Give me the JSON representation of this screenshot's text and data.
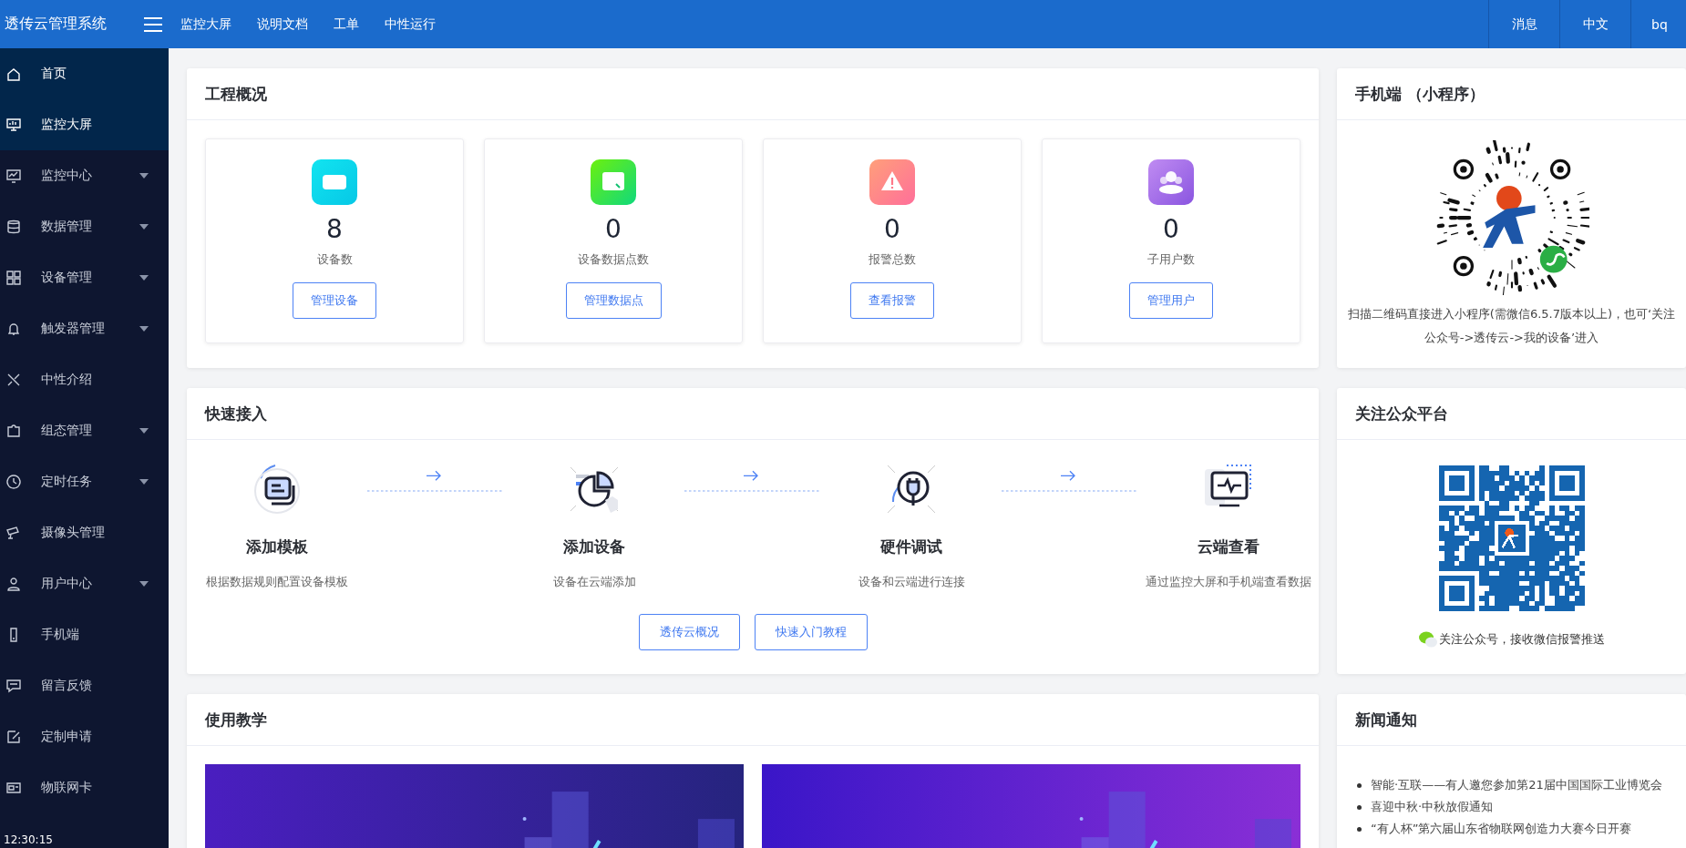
{
  "header": {
    "title": "透传云管理系统",
    "menu_items": [
      "监控大屏",
      "说明文档",
      "工单",
      "中性运行"
    ],
    "right_items": [
      "消息",
      "中文",
      "bq"
    ]
  },
  "sidebar": {
    "items": [
      {
        "label": "首页",
        "selected": true,
        "expandable": false
      },
      {
        "label": "监控大屏",
        "selected": true,
        "expandable": false
      },
      {
        "label": "监控中心",
        "selected": false,
        "expandable": true
      },
      {
        "label": "数据管理",
        "selected": false,
        "expandable": true
      },
      {
        "label": "设备管理",
        "selected": false,
        "expandable": true
      },
      {
        "label": "触发器管理",
        "selected": false,
        "expandable": true
      },
      {
        "label": "中性介绍",
        "selected": false,
        "expandable": false
      },
      {
        "label": "组态管理",
        "selected": false,
        "expandable": true
      },
      {
        "label": "定时任务",
        "selected": false,
        "expandable": true
      },
      {
        "label": "摄像头管理",
        "selected": false,
        "expandable": false
      },
      {
        "label": "用户中心",
        "selected": false,
        "expandable": true
      },
      {
        "label": "手机端",
        "selected": false,
        "expandable": false
      },
      {
        "label": "留言反馈",
        "selected": false,
        "expandable": false
      },
      {
        "label": "定制申请",
        "selected": false,
        "expandable": false
      },
      {
        "label": "物联网卡",
        "selected": false,
        "expandable": false
      }
    ],
    "clock": "12:30:15"
  },
  "overview": {
    "title": "工程概况",
    "stats": [
      {
        "value": "8",
        "label": "设备数",
        "button": "管理设备"
      },
      {
        "value": "0",
        "label": "设备数据点数",
        "button": "管理数据点"
      },
      {
        "value": "0",
        "label": "报警总数",
        "button": "查看报警"
      },
      {
        "value": "0",
        "label": "子用户数",
        "button": "管理用户"
      }
    ]
  },
  "mobile": {
    "title": "手机端 （小程序）",
    "description": "扫描二维码直接进入小程序(需微信6.5.7版本以上)，也可‘关注公众号->透传云->我的设备’进入"
  },
  "quick_access": {
    "title": "快速接入",
    "steps": [
      {
        "title": "添加模板",
        "description": "根据数据规则配置设备模板"
      },
      {
        "title": "添加设备",
        "description": "设备在云端添加"
      },
      {
        "title": "硬件调试",
        "description": "设备和云端进行连接"
      },
      {
        "title": "云端查看",
        "description": "通过监控大屏和手机端查看数据"
      }
    ],
    "buttons": [
      "透传云概况",
      "快速入门教程"
    ]
  },
  "official_account": {
    "title": "关注公众平台",
    "caption": "关注公众号，接收微信报警推送"
  },
  "tutorial": {
    "title": "使用教学"
  },
  "news": {
    "title": "新闻通知",
    "items": [
      "智能·互联——有人邀您参加第21届中国国际工业博览会",
      "喜迎中秋·中秋放假通知",
      "“有人杯”第六届山东省物联网创造力大赛今日开赛"
    ]
  }
}
